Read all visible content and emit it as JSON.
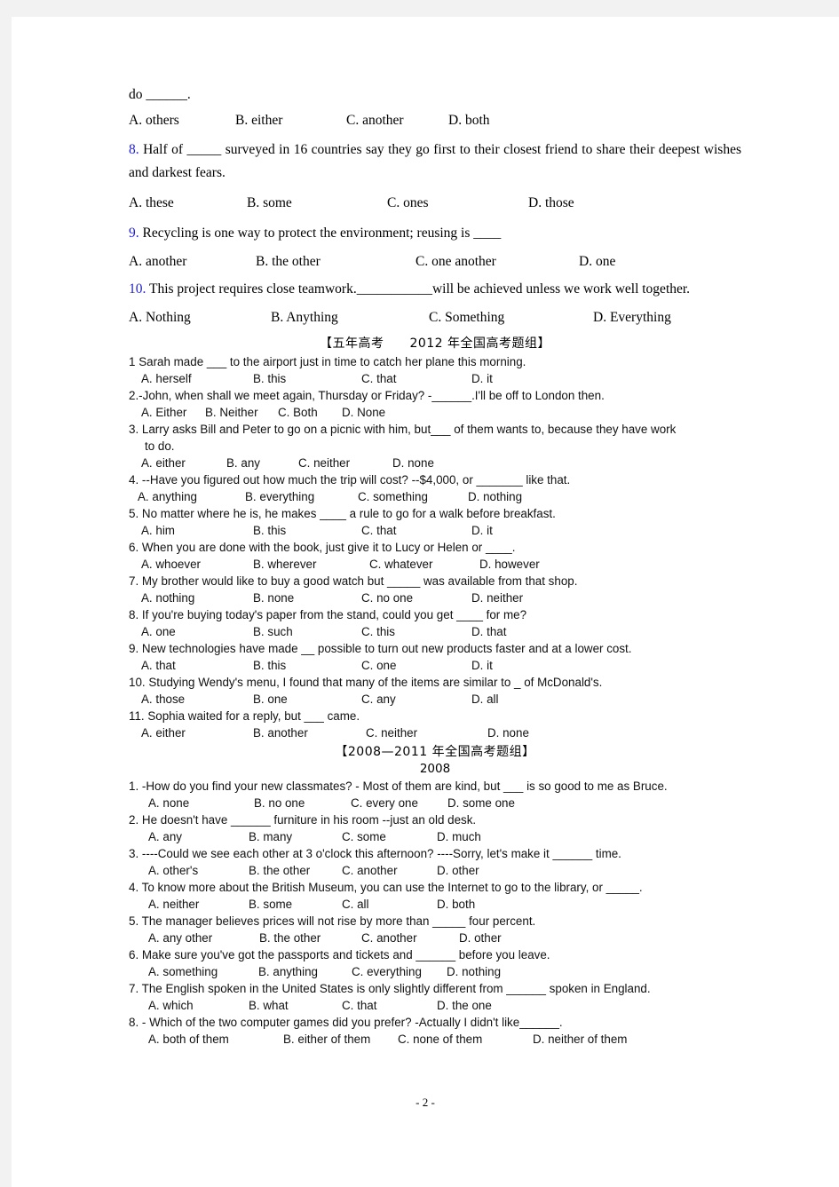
{
  "page": {
    "footer": "- 2 -"
  },
  "serif_section": {
    "carryover_line": "do ______.",
    "carryover_options": [
      "A. others",
      "B. either",
      "C. another",
      "D. both"
    ],
    "questions": [
      {
        "num": "8.",
        "text": "Half of _____ surveyed in 16 countries say they go first to their closest friend to share their deepest wishes and darkest fears.",
        "options": [
          "A. these",
          "B. some",
          "C. ones",
          "D. those"
        ]
      },
      {
        "num": "9.",
        "text": "Recycling is one way to protect the environment; reusing is ____",
        "options": [
          "A. another",
          "B. the other",
          "C. one another",
          "D. one"
        ]
      },
      {
        "num": "10.",
        "text": "This project requires close teamwork.___________will be achieved unless we work well together.",
        "options": [
          "A. Nothing",
          "B. Anything",
          "C. Something",
          "D. Everything"
        ]
      }
    ]
  },
  "section_2012": {
    "heading": "【五年高考　　2012 年全国高考题组】",
    "questions": [
      {
        "num": "1",
        "text": "Sarah made ___ to the airport just in time to catch her plane this morning.",
        "options": [
          "A. herself",
          "B. this",
          "C. that",
          "D. it"
        ]
      },
      {
        "num": "2.",
        "text": "-John, when shall we meet again, Thursday or Friday?    -______.I'll be off to London then.",
        "options": [
          "A. Either",
          "B. Neither",
          "C. Both",
          "D. None"
        ]
      },
      {
        "num": "3.",
        "text": "Larry asks Bill and Peter to go on a picnic with him, but___ of them wants to, because they have work",
        "text_cont": "to do.",
        "options": [
          "A. either",
          "B. any",
          "C. neither",
          "D. none"
        ]
      },
      {
        "num": "4.",
        "text": "--Have you figured out how much the trip will cost?    --$4,000, or _______ like that.",
        "options": [
          "A. anything",
          "B. everything",
          "C. something",
          "D. nothing"
        ]
      },
      {
        "num": "5.",
        "text": "No matter where he is, he makes ____ a rule to go for a walk before breakfast.",
        "options": [
          "A. him",
          "B. this",
          "C. that",
          "D. it"
        ]
      },
      {
        "num": "6.",
        "text": "When you are done with the book, just give it to Lucy or Helen or ____.",
        "options": [
          "A. whoever",
          "B. wherever",
          "C. whatever",
          "D. however"
        ]
      },
      {
        "num": "7.",
        "text": "My brother would like to buy a good watch but _____ was available from that shop.",
        "options": [
          "A. nothing",
          "B. none",
          "C. no one",
          "D. neither"
        ]
      },
      {
        "num": "8.",
        "text": "If you're buying today's paper from the stand, could you get ____ for me?",
        "options": [
          "A. one",
          "B. such",
          "C. this",
          "D. that"
        ]
      },
      {
        "num": "9.",
        "text": "New technologies have made __ possible to turn out new products faster and at a lower cost.",
        "options": [
          "A. that",
          "B. this",
          "C. one",
          "D. it"
        ]
      },
      {
        "num": "10.",
        "text": "Studying Wendy's menu, I found that many of the items are similar to _ of McDonald's.",
        "options": [
          "A. those",
          "B. one",
          "C. any",
          "D. all"
        ]
      },
      {
        "num": "11.",
        "text": "Sophia waited for a reply, but ___ came.",
        "options": [
          "A. either",
          "B. another",
          "C. neither",
          "D. none"
        ]
      }
    ]
  },
  "section_2008_2011": {
    "heading": "【2008—2011 年全国高考题组】",
    "year": "2008",
    "questions": [
      {
        "num": "1.",
        "text": "-How do you find your new classmates?   - Most of them are kind, but ___ is so good to me as Bruce.",
        "options": [
          "A. none",
          "B. no one",
          "C. every one",
          "D. some one"
        ]
      },
      {
        "num": "2.",
        "text": "He doesn't have ______ furniture in his room --just an old desk.",
        "options": [
          "A. any",
          "B. many",
          "C. some",
          "D. much"
        ]
      },
      {
        "num": "3.",
        "text": "----Could we see each other at 3 o'clock this afternoon?    ----Sorry, let's make it ______ time.",
        "options": [
          "A. other's",
          "B. the other",
          "C. another",
          "D. other"
        ]
      },
      {
        "num": "4.",
        "text": "To know more about the British Museum, you can use the Internet to go to the library, or _____.",
        "options": [
          "A. neither",
          "B. some",
          "C. all",
          "D. both"
        ]
      },
      {
        "num": "5.",
        "text": "The manager believes prices will not rise by more than _____ four percent.",
        "options": [
          "A. any other",
          "B. the other",
          "C. another",
          "D. other"
        ]
      },
      {
        "num": "6.",
        "text": "Make sure you've got the passports and tickets and ______ before you leave.",
        "options": [
          "A. something",
          "B. anything",
          "C. everything",
          "D. nothing"
        ]
      },
      {
        "num": "7.",
        "text": "The English spoken in the United States is only slightly different from ______ spoken in England.",
        "options": [
          "A. which",
          "B. what",
          "C. that",
          "D. the one"
        ]
      },
      {
        "num": "8.",
        "text": "- Which of the two computer games did you prefer?    -Actually I didn't like______.",
        "options": [
          "A. both of them",
          "B. either of them",
          "C. none of them",
          "D. neither of them"
        ]
      }
    ]
  },
  "colors": {
    "question_number_blue": "#2222cc",
    "page_background": "#ffffff",
    "canvas_background": "#f2f2f2"
  }
}
